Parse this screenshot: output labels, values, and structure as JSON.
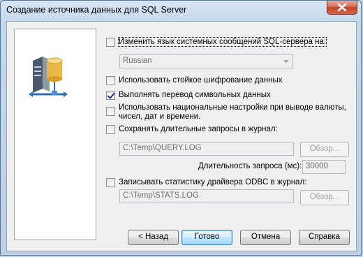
{
  "window": {
    "title": "Создание источника данных для SQL Server"
  },
  "options": {
    "change_language": {
      "label": "Изменить язык системных сообщений SQL-сервера на:",
      "checked": false
    },
    "language_select": {
      "value": "Russian"
    },
    "strong_encryption": {
      "label": "Использовать стойкое шифрование данных",
      "checked": false
    },
    "char_translation": {
      "label": "Выполнять перевод символьных данных",
      "checked": true
    },
    "regional_settings": {
      "label": "Использовать национальные настройки при выводе валюты, чисел, дат и времени.",
      "checked": false
    },
    "save_long_queries": {
      "label": "Сохранять длительные запросы в журнал:",
      "checked": false
    },
    "query_log_path": "C:\\Temp\\QUERY.LOG",
    "query_browse": "Обзор...",
    "query_duration_label": "Длительность запроса (мс):",
    "query_duration_value": "30000",
    "log_driver_stats": {
      "label": "Записывать статистику драйвера ODBC в журнал:",
      "checked": false
    },
    "stats_log_path": "C:\\Temp\\STATS.LOG",
    "stats_browse": "Обзор..."
  },
  "buttons": {
    "back": "< Назад",
    "finish": "Готово",
    "cancel": "Отмена",
    "help": "Справка"
  },
  "icons": [
    "close-icon",
    "database-server-icon"
  ],
  "colors": {
    "accent": "#3c7fb1",
    "close": "#c2422c"
  }
}
